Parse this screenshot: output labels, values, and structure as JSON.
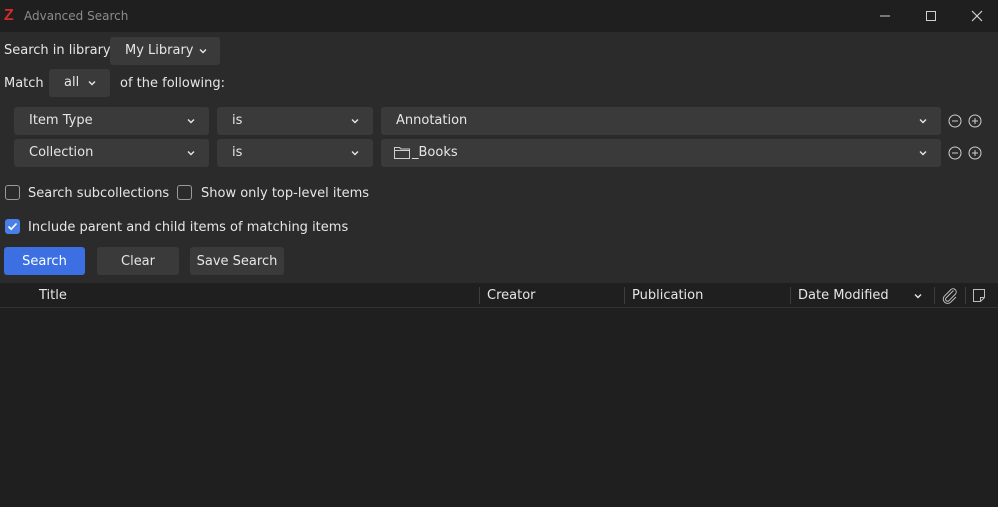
{
  "window": {
    "title": "Advanced Search",
    "logo_letter": "Z"
  },
  "search_in": {
    "label": "Search in library:",
    "value": "My Library"
  },
  "match": {
    "label": "Match",
    "value": "all",
    "suffix": "of the following:"
  },
  "conditions": [
    {
      "field": "Item Type",
      "operator": "is",
      "value": "Annotation",
      "value_icon": ""
    },
    {
      "field": "Collection",
      "operator": "is",
      "value": "_Books",
      "value_icon": "folder-icon"
    }
  ],
  "options": {
    "search_subcollections": {
      "label": "Search subcollections",
      "checked": false
    },
    "show_top_level": {
      "label": "Show only top-level items",
      "checked": false
    },
    "include_parent_child": {
      "label": "Include parent and child items of matching items",
      "checked": true
    }
  },
  "buttons": {
    "search": "Search",
    "clear": "Clear",
    "save_search": "Save Search"
  },
  "columns": {
    "title": "Title",
    "creator": "Creator",
    "publication": "Publication",
    "date_modified": "Date Modified",
    "attachments_icon": "paperclip-icon",
    "notes_icon": "note-icon"
  },
  "colors": {
    "accent": "#3c6fe2",
    "logo": "#d42a2a",
    "panel": "#2b2b2b",
    "background": "#1f1f1f",
    "control": "#3a3a3a"
  }
}
